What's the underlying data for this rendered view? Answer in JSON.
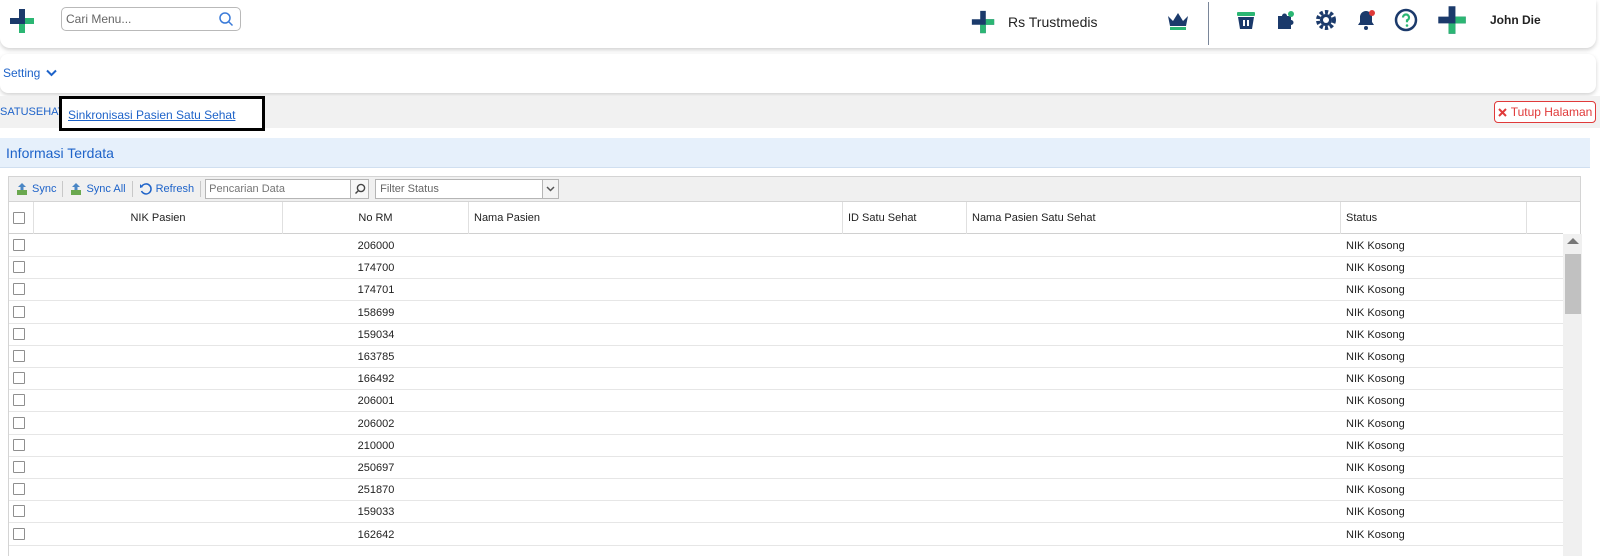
{
  "header": {
    "search_placeholder": "Cari Menu...",
    "hospital_name": "Rs Trustmedis",
    "user_name": "John Die"
  },
  "menu": {
    "setting_label": "Setting"
  },
  "tabs": {
    "root_label": "SATUSEHAT",
    "active_label": "Sinkronisasi Pasien Satu Sehat",
    "close_label": "Tutup Halaman"
  },
  "panel": {
    "title": "Informasi Terdata"
  },
  "toolbar": {
    "sync_label": "Sync",
    "sync_all_label": "Sync All",
    "refresh_label": "Refresh",
    "search_placeholder": "Pencarian Data",
    "filter_placeholder": "Filter Status"
  },
  "table": {
    "columns": [
      "NIK Pasien",
      "No RM",
      "Nama Pasien",
      "ID Satu Sehat",
      "Nama Pasien Satu Sehat",
      "Status"
    ],
    "rows": [
      {
        "no_rm": "206000",
        "status": "NIK Kosong"
      },
      {
        "no_rm": "174700",
        "status": "NIK Kosong"
      },
      {
        "no_rm": "174701",
        "status": "NIK Kosong"
      },
      {
        "no_rm": "158699",
        "status": "NIK Kosong"
      },
      {
        "no_rm": "159034",
        "status": "NIK Kosong"
      },
      {
        "no_rm": "163785",
        "status": "NIK Kosong"
      },
      {
        "no_rm": "166492",
        "status": "NIK Kosong"
      },
      {
        "no_rm": "206001",
        "status": "NIK Kosong"
      },
      {
        "no_rm": "206002",
        "status": "NIK Kosong"
      },
      {
        "no_rm": "210000",
        "status": "NIK Kosong"
      },
      {
        "no_rm": "250697",
        "status": "NIK Kosong"
      },
      {
        "no_rm": "251870",
        "status": "NIK Kosong"
      },
      {
        "no_rm": "159033",
        "status": "NIK Kosong"
      },
      {
        "no_rm": "162642",
        "status": "NIK Kosong"
      }
    ]
  },
  "colors": {
    "brand_blue": "#1e63c9",
    "brand_green": "#2bb673",
    "icon_navy": "#1b3a6b",
    "danger": "#e03a3a"
  },
  "icons": {
    "logo": "cross-logo-icon",
    "search": "search-icon",
    "crown": "crown-icon",
    "basket": "basket-icon",
    "puzzle": "puzzle-icon",
    "gear": "gear-icon",
    "bell": "bell-icon",
    "help": "help-icon"
  }
}
